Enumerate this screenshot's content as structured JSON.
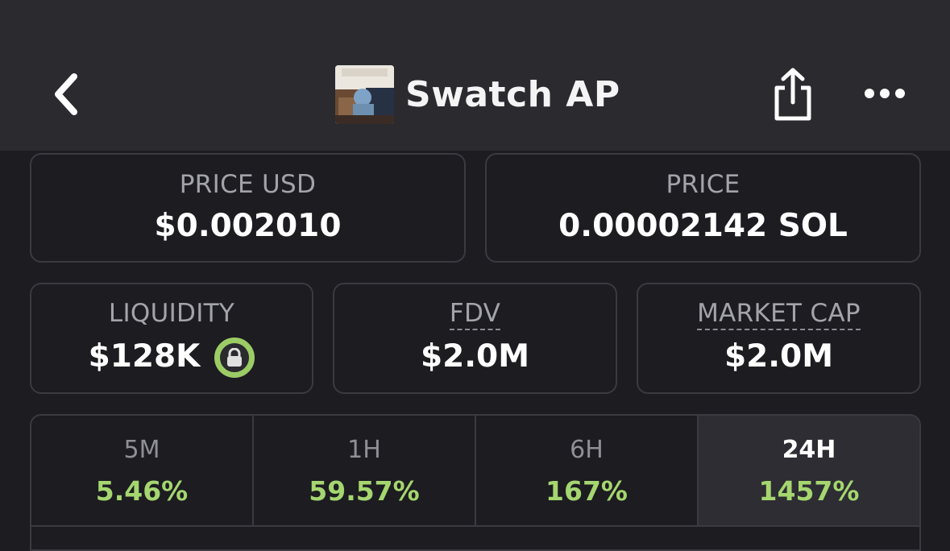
{
  "header": {
    "title": "Swatch AP",
    "back_icon": "chevron-left-icon",
    "share_icon": "share-icon",
    "more_icon": "more-horizontal-icon"
  },
  "price_usd": {
    "label": "PRICE USD",
    "value": "$0.002010"
  },
  "price_native": {
    "label": "PRICE",
    "value": "0.00002142 SOL"
  },
  "liquidity": {
    "label": "LIQUIDITY",
    "value": "$128K",
    "lock_icon": "lock-icon",
    "lock_color": "#9ccc65"
  },
  "fdv": {
    "label": "FDV",
    "value": "$2.0M"
  },
  "market_cap": {
    "label": "MARKET CAP",
    "value": "$2.0M"
  },
  "timeframes": [
    {
      "label": "5M",
      "value": "5.46%"
    },
    {
      "label": "1H",
      "value": "59.57%"
    },
    {
      "label": "6H",
      "value": "167%"
    },
    {
      "label": "24H",
      "value": "1457%",
      "active": true
    }
  ],
  "colors": {
    "positive": "#a5d66f",
    "background": "#1c1c21",
    "header": "#2a2a2f"
  }
}
